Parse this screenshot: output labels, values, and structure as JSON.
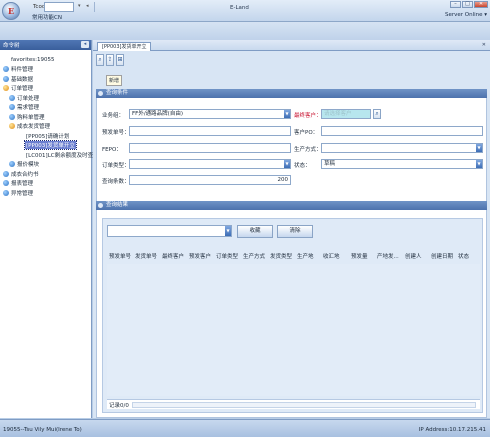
{
  "titlebar": {
    "tcode_label": "Tcode",
    "favorites_label": "常用功能CN",
    "window_title": "E-Land",
    "server_status": "Server Online",
    "min_glyph": "–",
    "max_glyph": "□",
    "close_glyph": "✕"
  },
  "sidebar": {
    "header": "命令树",
    "items": [
      {
        "label": "favorites:19055"
      },
      {
        "label": "料件管理"
      },
      {
        "label": "基础数据"
      },
      {
        "label": "订单管理"
      },
      {
        "label": "订单处理"
      },
      {
        "label": "需求管理"
      },
      {
        "label": "购料单管理"
      },
      {
        "label": "成衣发货管理"
      },
      {
        "label": "[PP005]请确计划"
      },
      {
        "label": "[PP003]发货单开立"
      },
      {
        "label": "[LC001]LC剩余额度及时查询"
      },
      {
        "label": "报价模块"
      },
      {
        "label": "成衣合约书"
      },
      {
        "label": "报表管理"
      },
      {
        "label": "异常管理"
      }
    ]
  },
  "tabs": [
    {
      "label": "[PP003]发货单开立"
    }
  ],
  "toolbar": {
    "tooltip": "新增"
  },
  "form": {
    "section_title": "查询条件",
    "business_label": "业务组：",
    "business_value": "FF外/通路品牌(自由)",
    "customer_label": "最终客户：",
    "customer_placeholder": "请选择客户",
    "forecast_no_label": "预发单号：",
    "customer_po_label": "客户PO：",
    "fepo_label": "FEPO：",
    "production_mode_label": "生产方式：",
    "order_type_label": "订单类型：",
    "status_label": "状态：",
    "status_value": "草稿",
    "query_count_label": "查询条数：",
    "query_count_value": "200"
  },
  "results": {
    "section_title": "查询结果",
    "collect_button": "收藏",
    "clear_button": "清除",
    "columns": [
      "预发单号",
      "发货单号",
      "最终客户",
      "预发客户",
      "订单类型",
      "生产方式",
      "发货类型",
      "生产地",
      "收汇地",
      "预发量",
      "产地发...",
      "创建人",
      "创建日期",
      "状态"
    ],
    "record_count": "记录0/0"
  },
  "statusbar": {
    "user": "19055--Tsu Vily Mui(Irene To)",
    "ip": "IP Address:10.17.215.41"
  },
  "colors": {
    "header_blue": "#4d72ad",
    "selected_item": "#6b7fd0",
    "disabled_field": "#b7e6ee",
    "required_red": "#c8102e"
  }
}
